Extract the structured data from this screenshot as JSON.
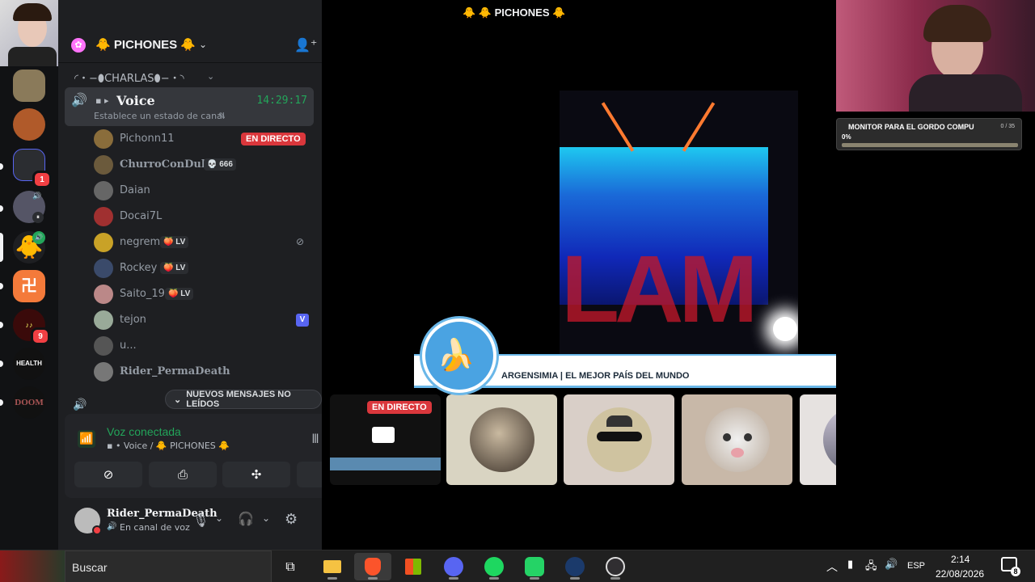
{
  "server": {
    "name": "🐥 PICHONES 🐥",
    "category": "◜・−⬮CHARLAS⬮−・◝",
    "voice_channel": {
      "name": "Voice",
      "timer": "14:29:17",
      "status_placeholder": "Establece un estado de canal"
    },
    "members": [
      {
        "name": "Pichonn11",
        "tag": "",
        "live": "EN DIRECTO",
        "color": "#8a6d3b"
      },
      {
        "name": "ChurroConDulce",
        "tag": "💀 666",
        "live": "",
        "color": "#6b5a3c"
      },
      {
        "name": "Daian",
        "tag": "",
        "live": "",
        "color": "#666"
      },
      {
        "name": "Docai7L",
        "tag": "",
        "live": "",
        "color": "#a03030"
      },
      {
        "name": "negrem",
        "tag": "🍑 LV",
        "live": "",
        "color": "#c9a227"
      },
      {
        "name": "Rockey",
        "tag": "🍑 LV",
        "live": "",
        "color": "#3a4a6a"
      },
      {
        "name": "Saito_19",
        "tag": "🍑 LV",
        "live": "",
        "color": "#b88"
      },
      {
        "name": "tejon",
        "tag": "",
        "live": "",
        "color": "#9a9"
      },
      {
        "name": "u...",
        "tag": "",
        "live": "",
        "color": "#555"
      },
      {
        "name": "Rider_PermaDeath",
        "tag": "",
        "live": "",
        "color": "#777"
      }
    ],
    "unread_label": "NUEVOS MENSAJES NO LEÍDOS"
  },
  "voice_panel": {
    "title": "Voz conectada",
    "subtitle": "▪ • Voice / 🐥 PICHONES 🐥"
  },
  "user": {
    "name": "Rider_PermaDeath",
    "status": "En canal de voz"
  },
  "stage": {
    "title": "🐥 🐥 PICHONES 🐥",
    "live_label": "EN DIRECTO",
    "banner_text": "ARGENSIMIA | EL MEJOR PAÍS DEL MUNDO",
    "banner_emoji": "🍌",
    "video_overlay_text": "LAM"
  },
  "goal_widget": {
    "title": "MONITOR PARA EL GORDO COMPU",
    "count": "0 / 35",
    "percent": "0%",
    "progress": 0
  },
  "server_badges": [
    "1",
    "9"
  ],
  "taskbar": {
    "search_label": "Buscar",
    "language": "ESP",
    "time": "2:14",
    "date": "22/08/2026",
    "notifications": "8"
  },
  "colors": {
    "accent_green": "#23a55a",
    "live_red": "#da373c",
    "banner_blue": "#6ab7e8"
  }
}
